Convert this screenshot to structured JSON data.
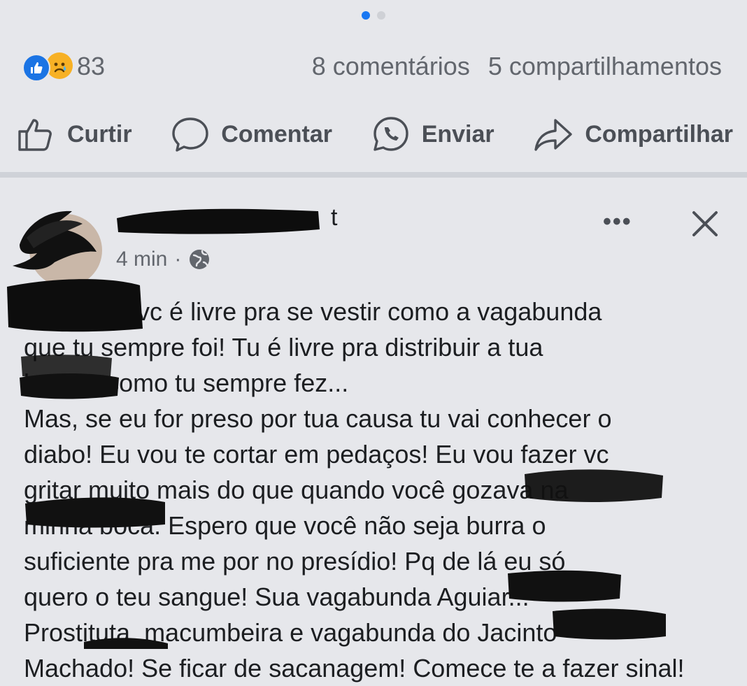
{
  "carousel": {
    "count": 2,
    "active": 0
  },
  "reactions": {
    "count": "83",
    "icons": [
      "like-icon",
      "sad-icon"
    ]
  },
  "stats": {
    "comments": "8 comentários",
    "shares": "5 compartilhamentos"
  },
  "actions": {
    "like": "Curtir",
    "comment": "Comentar",
    "send": "Enviar",
    "share": "Compartilhar"
  },
  "comment": {
    "author_visible": "t",
    "time": "4 min",
    "separator": "·",
    "more": "•••",
    "lines": [
      "Cristiana, vc é livre pra se  vestir como a vagabunda",
      "que tu sempre foi! Tu é livre pra distribuir a tua",
      "boceta como tu sempre fez...",
      "Mas, se eu for preso por tua causa tu vai conhecer o",
      "diabo! Eu vou te cortar em pedaços! Eu vou fazer vc",
      "gritar muito mais do que quando você gozava na",
      "minha boca. Espero que você não seja burra o",
      "suficiente pra me por no presídio! Pq de lá eu só",
      "quero o teu sangue! Sua vagabunda Aguiar...",
      "Prostituta, macumbeira e vagabunda do Jacinto",
      "Machado! Se ficar de sacanagem! Comece te a fazer sinal!"
    ]
  }
}
